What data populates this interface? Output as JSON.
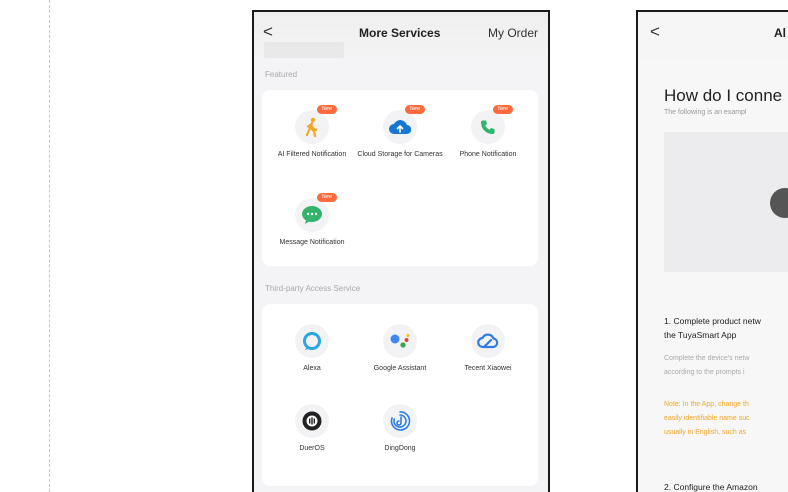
{
  "left_screen": {
    "back_glyph": "<",
    "title": "More Services",
    "header_action": "My Order",
    "sections": [
      {
        "label": "Featured",
        "services": [
          {
            "label": "AI Filtered Notification",
            "badge": "New",
            "icon": "walking-person-icon",
            "color": "#f5a623"
          },
          {
            "label": "Cloud Storage for Cameras",
            "badge": "New",
            "icon": "cloud-upload-icon",
            "color": "#1677d2"
          },
          {
            "label": "Phone Notification",
            "badge": "New",
            "icon": "phone-icon",
            "color": "#2db56b"
          },
          {
            "label": "Message Notification",
            "badge": "New",
            "icon": "chat-bubble-icon",
            "color": "#34b36b"
          }
        ]
      },
      {
        "label": "Third-party Access Service",
        "services": [
          {
            "label": "Alexa",
            "icon": "alexa-icon",
            "color": "#2aa6e0"
          },
          {
            "label": "Google Assistant",
            "icon": "google-assistant-icon",
            "color": "#4285f4"
          },
          {
            "label": "Tecent Xiaowei",
            "icon": "tencent-xiaowei-icon",
            "color": "#2e7de3"
          },
          {
            "label": "DuerOS",
            "icon": "dueros-icon",
            "color": "#222222"
          },
          {
            "label": "DingDong",
            "icon": "dingdong-icon",
            "color": "#2b7fe0"
          }
        ]
      }
    ]
  },
  "right_screen": {
    "back_glyph": "<",
    "title_partial": "Al",
    "heading_partial": "How do I conne",
    "subtitle_partial": "The following is an exampl",
    "step1_line1": "1. Complete product netw",
    "step1_line2": "the TuyaSmart App",
    "step1_desc_line1": "Complete the device's netw",
    "step1_desc_line2": "according to the prompts i",
    "note_line1": "Note: In the App, change th",
    "note_line2": "easily identifiable name suc",
    "note_line3": "usually in English, such as",
    "step2_partial": "2. Configure the Amazon"
  }
}
